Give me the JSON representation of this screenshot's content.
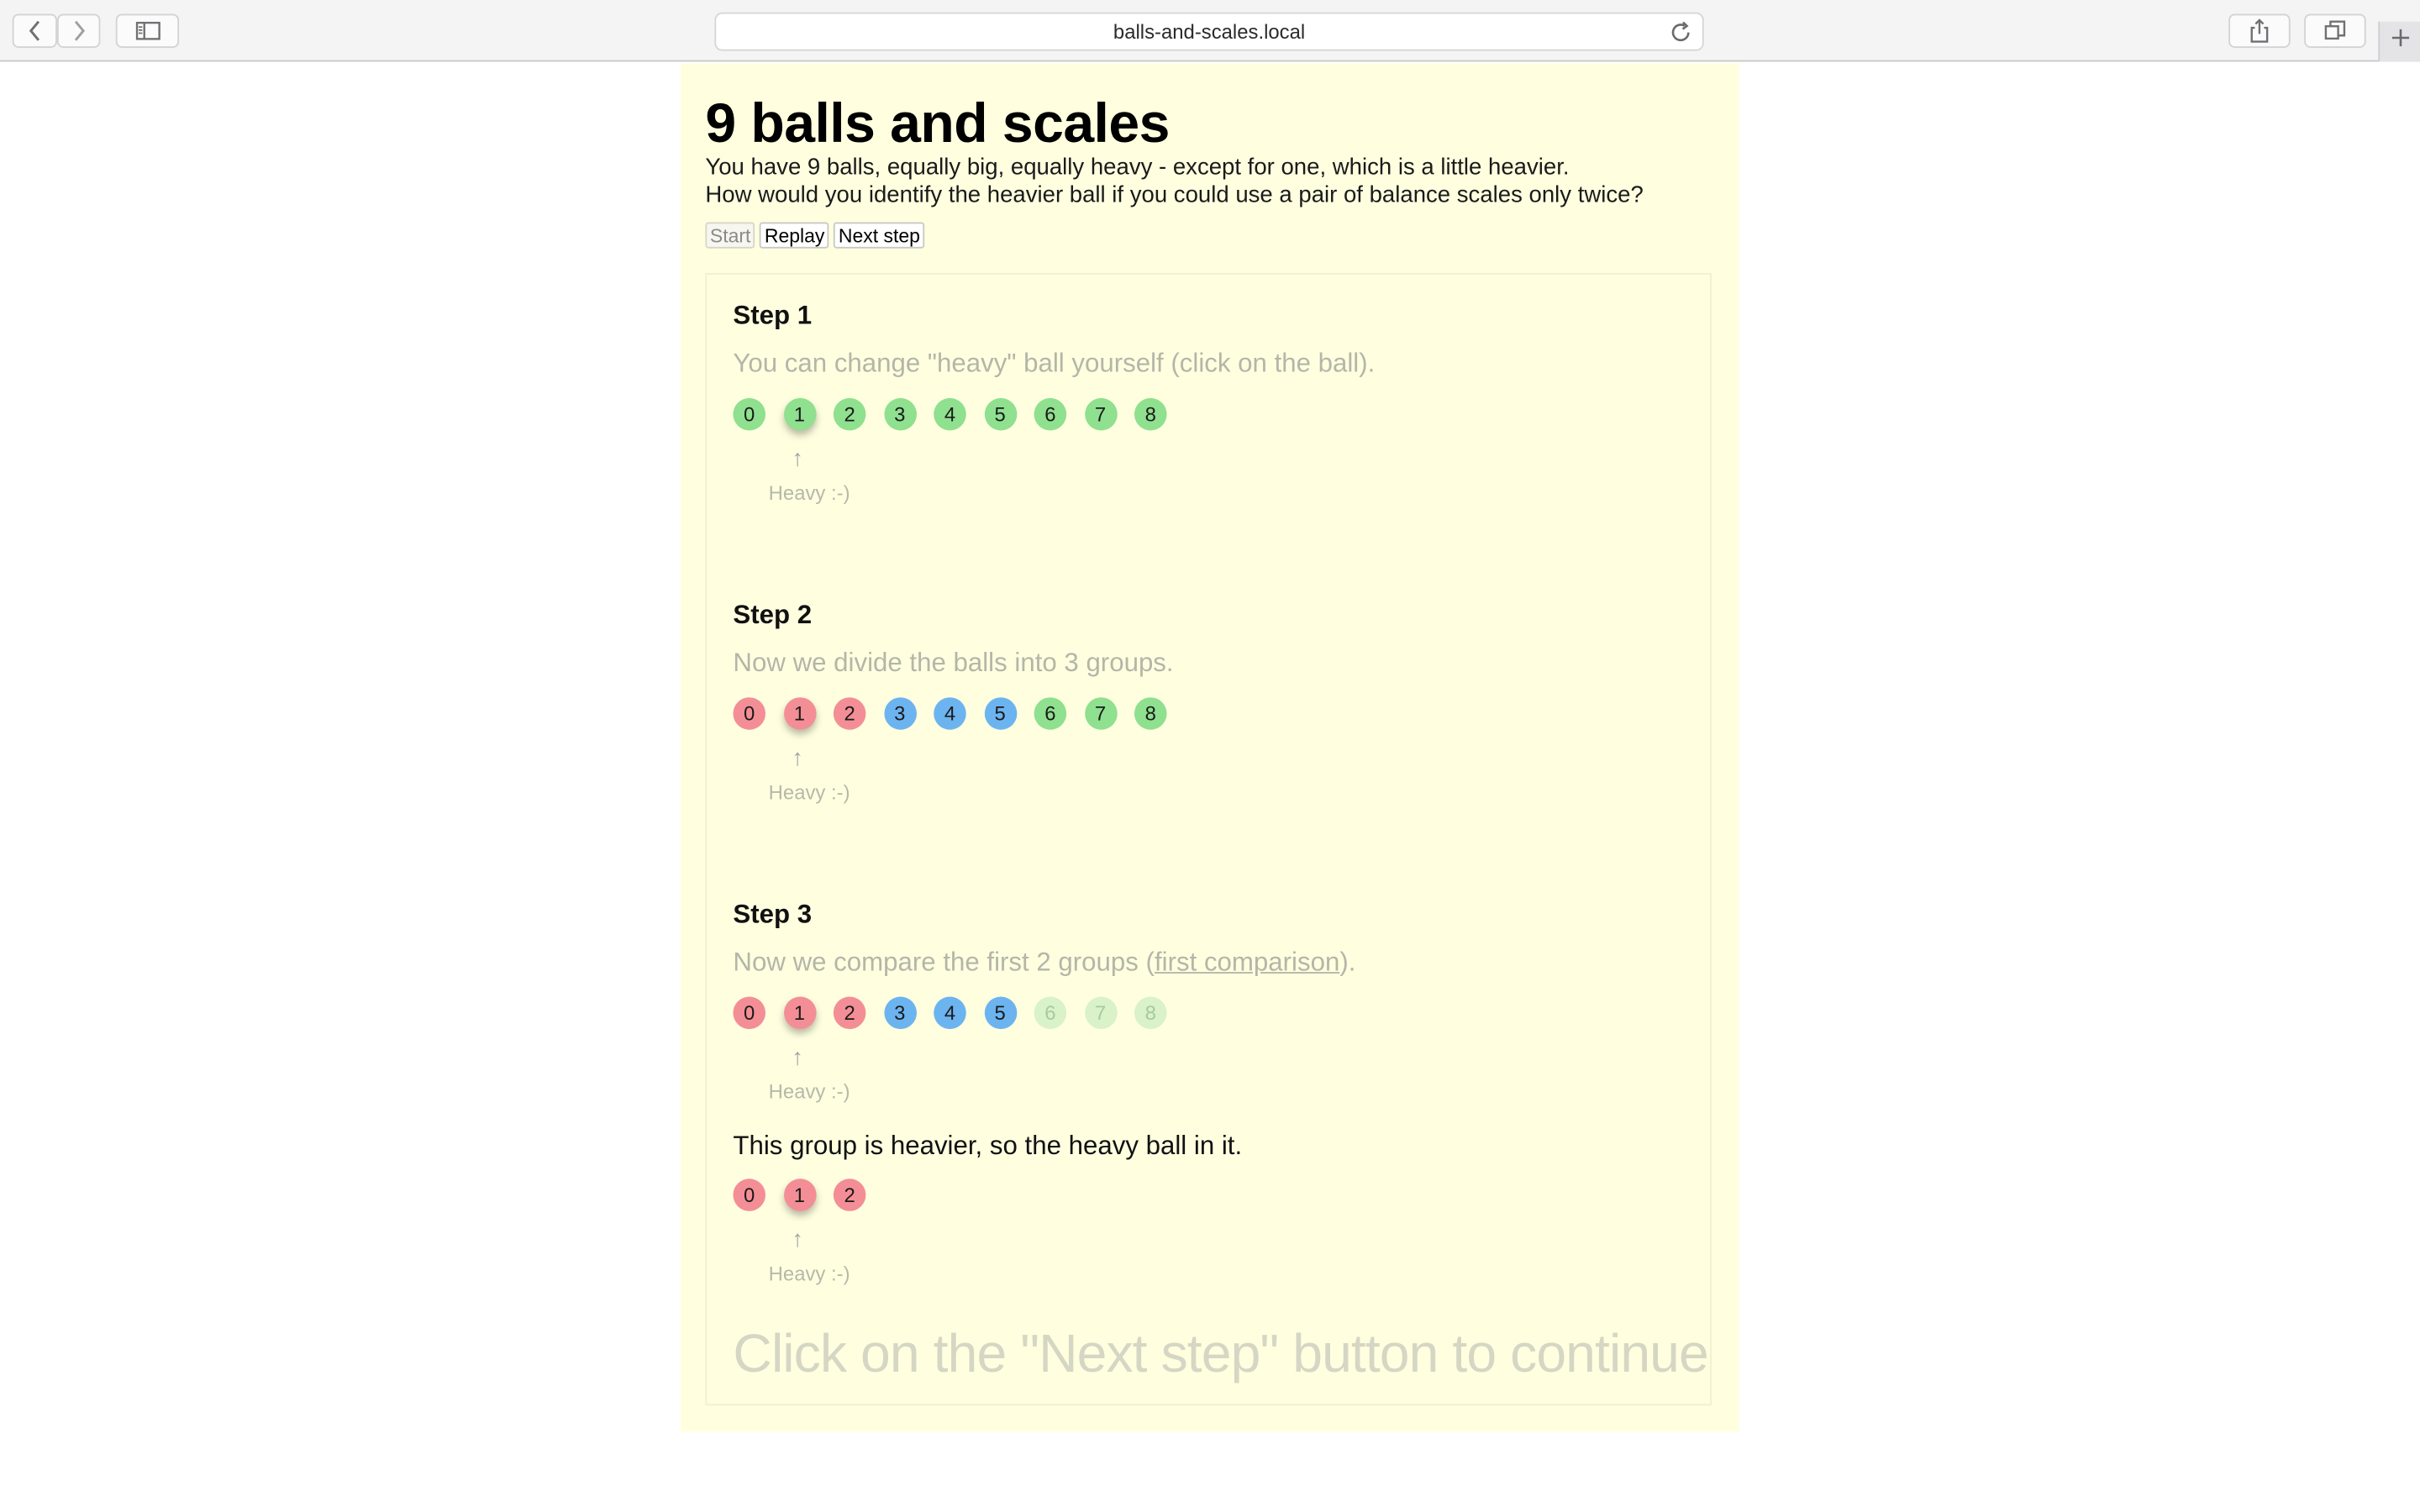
{
  "browser": {
    "url": "balls-and-scales.local",
    "icons": {
      "back": "chevron-left-icon",
      "forward": "chevron-right-icon",
      "sidebar": "sidebar-icon",
      "reload": "reload-icon",
      "share": "share-icon",
      "tabs": "tabs-overview-icon",
      "new_tab": "plus-icon"
    }
  },
  "page": {
    "title": "9 balls and scales",
    "intro_line1": "You have 9 balls, equally big, equally heavy - except for one, which is a little heavier.",
    "intro_line2": "How would you identify the heavier ball if you could use a pair of balance scales only twice?",
    "controls": {
      "start": "Start",
      "replay": "Replay",
      "next": "Next step"
    },
    "background_color": "#ffffe0"
  },
  "steps": [
    {
      "title": "Step 1",
      "description": "You can change \"heavy\" ball yourself (click on the ball).",
      "balls": [
        {
          "label": "0",
          "color": "green"
        },
        {
          "label": "1",
          "color": "green",
          "heavy": true
        },
        {
          "label": "2",
          "color": "green"
        },
        {
          "label": "3",
          "color": "green"
        },
        {
          "label": "4",
          "color": "green"
        },
        {
          "label": "5",
          "color": "green"
        },
        {
          "label": "6",
          "color": "green"
        },
        {
          "label": "7",
          "color": "green"
        },
        {
          "label": "8",
          "color": "green"
        }
      ],
      "arrow": "↑",
      "heavy_label": "Heavy :-)"
    },
    {
      "title": "Step 2",
      "description": "Now we divide the balls into 3 groups.",
      "balls": [
        {
          "label": "0",
          "color": "red"
        },
        {
          "label": "1",
          "color": "red",
          "heavy": true
        },
        {
          "label": "2",
          "color": "red"
        },
        {
          "label": "3",
          "color": "blue"
        },
        {
          "label": "4",
          "color": "blue"
        },
        {
          "label": "5",
          "color": "blue"
        },
        {
          "label": "6",
          "color": "green"
        },
        {
          "label": "7",
          "color": "green"
        },
        {
          "label": "8",
          "color": "green"
        }
      ],
      "arrow": "↑",
      "heavy_label": "Heavy :-)"
    },
    {
      "title": "Step 3",
      "description_before": "Now we compare the first 2 groups (",
      "description_link": "first comparison",
      "description_after": ").",
      "balls": [
        {
          "label": "0",
          "color": "red"
        },
        {
          "label": "1",
          "color": "red",
          "heavy": true
        },
        {
          "label": "2",
          "color": "red"
        },
        {
          "label": "3",
          "color": "blue"
        },
        {
          "label": "4",
          "color": "blue"
        },
        {
          "label": "5",
          "color": "blue"
        },
        {
          "label": "6",
          "color": "faded"
        },
        {
          "label": "7",
          "color": "faded"
        },
        {
          "label": "8",
          "color": "faded"
        }
      ],
      "arrow": "↑",
      "heavy_label": "Heavy :-)",
      "result_text": "This group is heavier, so the heavy ball in it.",
      "result_balls": [
        {
          "label": "0",
          "color": "red"
        },
        {
          "label": "1",
          "color": "red",
          "heavy": true
        },
        {
          "label": "2",
          "color": "red"
        }
      ],
      "result_arrow": "↑",
      "result_heavy_label": "Heavy :-)"
    }
  ],
  "continue_hint": "Click on the \"Next step\" button to continue",
  "colors": {
    "green": "#8fe08f",
    "red": "#f48e96",
    "blue": "#6cb4f0",
    "faded": "#d9f2c8"
  }
}
